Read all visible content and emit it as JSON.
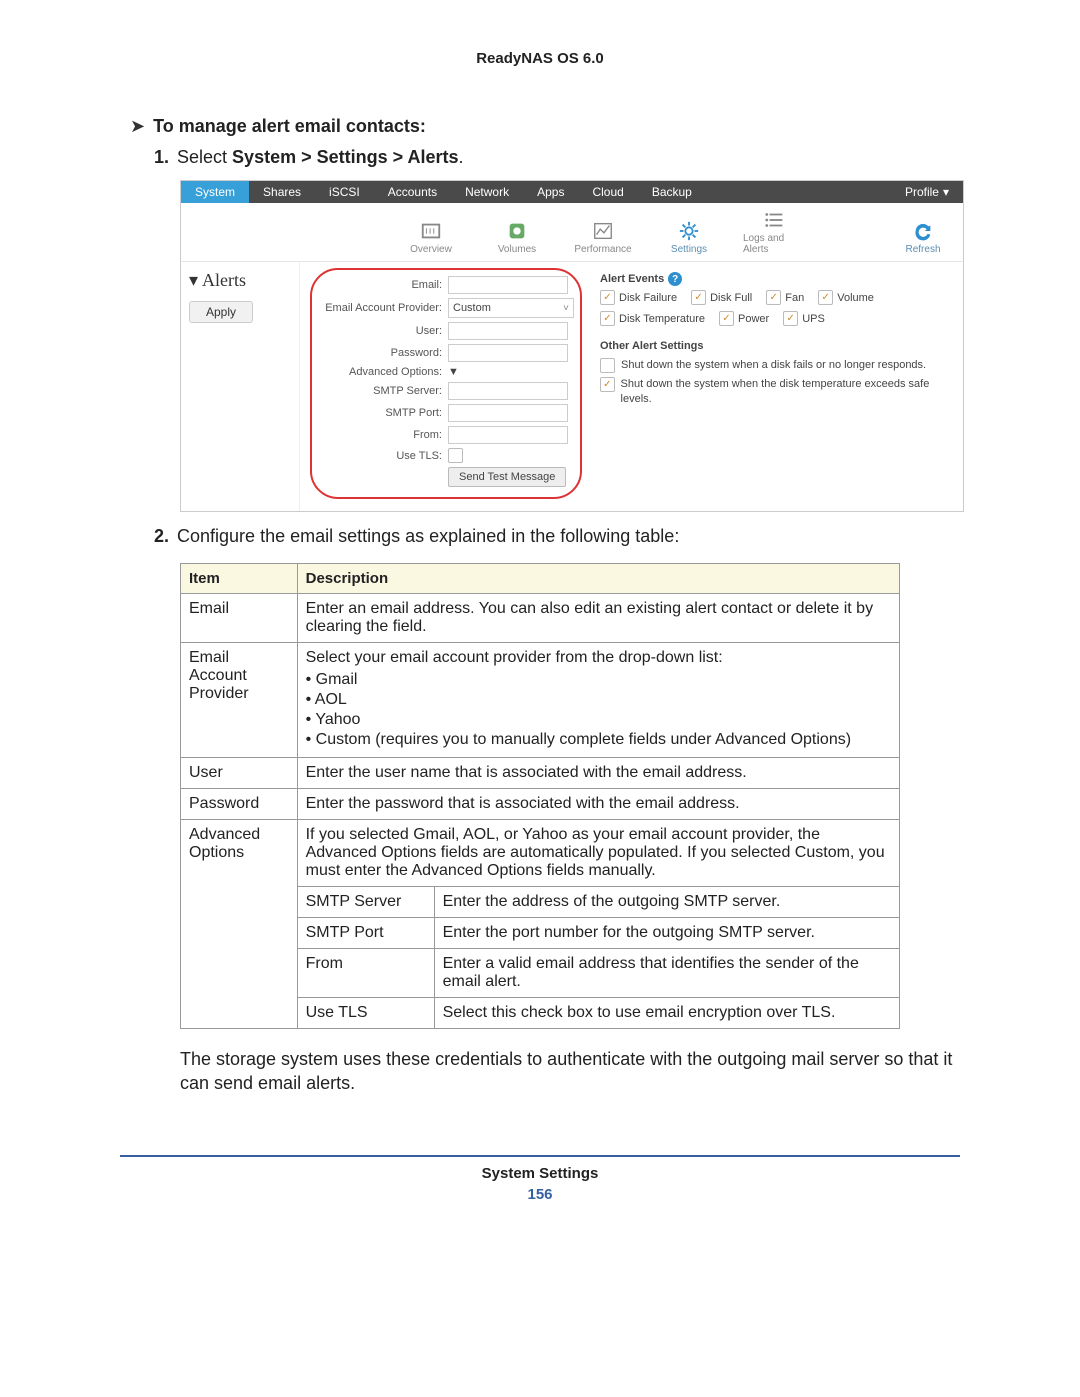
{
  "doc_header": "ReadyNAS OS 6.0",
  "intro": {
    "title": "To manage alert email contacts:",
    "step1_num": "1.",
    "step1_prefix": "Select ",
    "step1_bold": "System > Settings > Alerts",
    "step1_suffix": ".",
    "step2_num": "2.",
    "step2_text": "Configure the email settings as explained in the following table:"
  },
  "screenshot": {
    "nav": [
      "System",
      "Shares",
      "iSCSI",
      "Accounts",
      "Network",
      "Apps",
      "Cloud",
      "Backup"
    ],
    "profile": "Profile",
    "subnav": {
      "overview": "Overview",
      "volumes": "Volumes",
      "performance": "Performance",
      "settings": "Settings",
      "logs": "Logs and Alerts",
      "refresh": "Refresh"
    },
    "sidebar_title": "Alerts",
    "apply": "Apply",
    "form_labels": {
      "email": "Email:",
      "provider": "Email Account Provider:",
      "provider_value": "Custom",
      "user": "User:",
      "password": "Password:",
      "advanced": "Advanced Options:",
      "smtp_server": "SMTP Server:",
      "smtp_port": "SMTP Port:",
      "from": "From:",
      "use_tls": "Use TLS:",
      "send_test": "Send Test Message"
    },
    "alert_events_title": "Alert Events",
    "events": [
      "Disk Failure",
      "Disk Full",
      "Fan",
      "Volume",
      "Disk Temperature",
      "Power",
      "UPS"
    ],
    "other_title": "Other Alert Settings",
    "other": [
      "Shut down the system when a disk fails or no longer responds.",
      "Shut down the system when the disk temperature exceeds safe levels."
    ]
  },
  "table": {
    "headers": [
      "Item",
      "Description"
    ],
    "rows": [
      {
        "item": "Email",
        "desc": "Enter an email address. You can also edit an existing alert contact or delete it by clearing the field."
      },
      {
        "item": "Email Account Provider",
        "desc_intro": "Select your email account provider from the drop-down list:",
        "bullets": [
          "Gmail",
          "AOL",
          "Yahoo",
          "Custom (requires you to manually complete fields under Advanced Options)"
        ]
      },
      {
        "item": "User",
        "desc": "Enter the user name that is associated with the email address."
      },
      {
        "item": "Password",
        "desc": "Enter the password that is associated with the email address."
      },
      {
        "item": "Advanced Options",
        "desc": "If you selected Gmail, AOL, or Yahoo as your email account provider, the Advanced Options fields are automatically populated. If you selected Custom, you must enter the Advanced Options fields manually."
      }
    ],
    "sub_rows": [
      {
        "item": "SMTP Server",
        "desc": "Enter the address of the outgoing SMTP server."
      },
      {
        "item": "SMTP Port",
        "desc": "Enter the port number for the outgoing SMTP server."
      },
      {
        "item": "From",
        "desc": "Enter a valid email address that identifies the sender of the email alert."
      },
      {
        "item": "Use TLS",
        "desc": "Select this check box to use email encryption over TLS."
      }
    ]
  },
  "body_para": "The storage system uses these credentials to authenticate with the outgoing mail server so that it can send email alerts.",
  "footer": {
    "title": "System Settings",
    "page": "156"
  }
}
